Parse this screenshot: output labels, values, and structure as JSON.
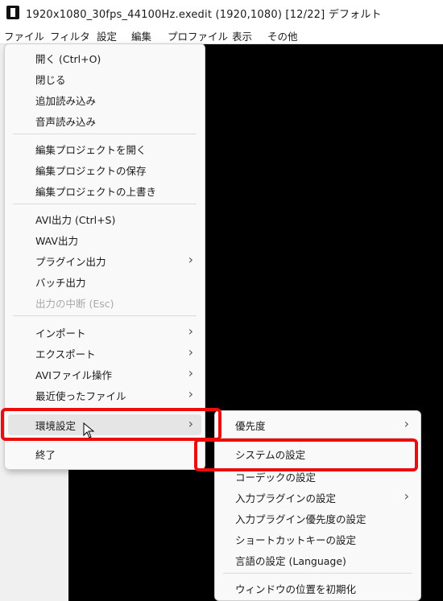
{
  "window": {
    "title": "1920x1080_30fps_44100Hz.exedit (1920,1080)  [12/22]  デフォルト"
  },
  "menubar": [
    {
      "label": "ファイル"
    },
    {
      "label": "フィルタ"
    },
    {
      "label": "設定"
    },
    {
      "label": "編集"
    },
    {
      "label": "プロファイル"
    },
    {
      "label": "表示"
    },
    {
      "label": "その他"
    }
  ],
  "file_menu": [
    {
      "label": "開く (Ctrl+O)"
    },
    {
      "label": "閉じる"
    },
    {
      "label": "追加読み込み"
    },
    {
      "label": "音声読み込み"
    },
    {
      "label": "編集プロジェクトを開く"
    },
    {
      "label": "編集プロジェクトの保存"
    },
    {
      "label": "編集プロジェクトの上書き"
    },
    {
      "label": "AVI出力 (Ctrl+S)"
    },
    {
      "label": "WAV出力"
    },
    {
      "label": "プラグイン出力",
      "submenu": true
    },
    {
      "label": "バッチ出力"
    },
    {
      "label": "出力の中断 (Esc)",
      "disabled": true
    },
    {
      "label": "インポート",
      "submenu": true
    },
    {
      "label": "エクスポート",
      "submenu": true
    },
    {
      "label": "AVIファイル操作",
      "submenu": true
    },
    {
      "label": "最近使ったファイル",
      "submenu": true
    },
    {
      "label": "環境設定",
      "submenu": true,
      "hovered": true
    },
    {
      "label": "終了"
    }
  ],
  "submenu_arrow": "›",
  "env_submenu": [
    {
      "label": "優先度",
      "submenu": true
    },
    {
      "label": "システムの設定"
    },
    {
      "label": "コーデックの設定"
    },
    {
      "label": "入力プラグインの設定",
      "submenu": true
    },
    {
      "label": "入力プラグイン優先度の設定"
    },
    {
      "label": "ショートカットキーの設定"
    },
    {
      "label": "言語の設定 (Language)"
    },
    {
      "label": "ウィンドウの位置を初期化"
    }
  ],
  "colors": {
    "highlight_border": "#ee0b0b",
    "video_bg": "#000000"
  }
}
